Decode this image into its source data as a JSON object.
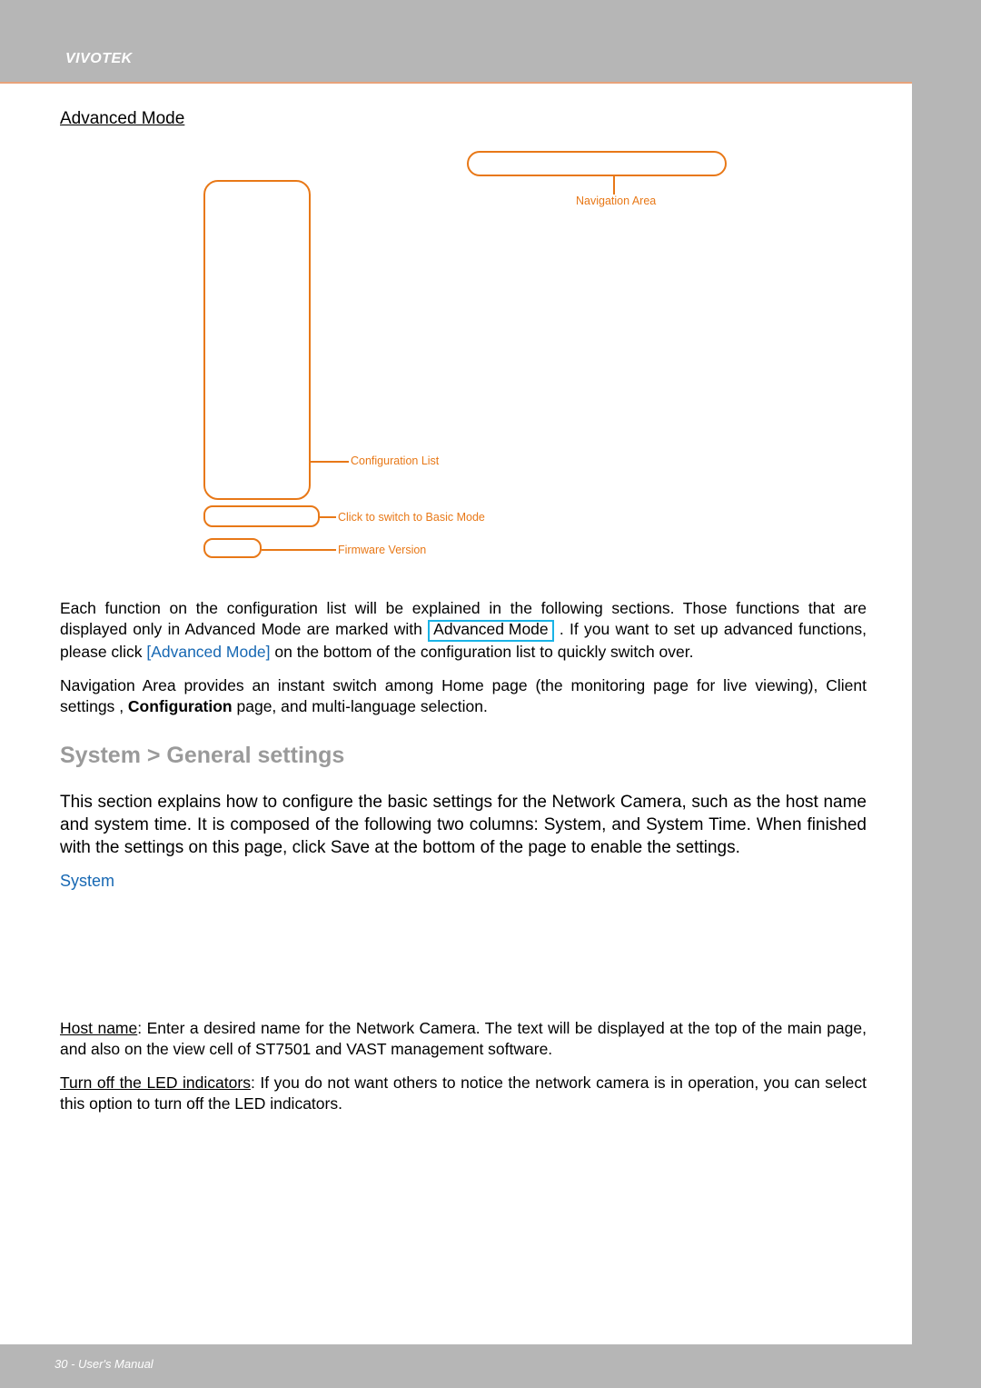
{
  "brand": "VIVOTEK",
  "section_title": "Advanced Mode",
  "diagram": {
    "navigation_area": "Navigation Area",
    "configuration_list": "Configuration List",
    "switch_basic": "Click to switch to Basic Mode",
    "firmware_version": "Firmware Version"
  },
  "para1_a": "Each function on the configuration list will be explained in the following sections. Those functions that are displayed only in Advanced Mode are marked with ",
  "adv_mode_badge": "Advanced Mode",
  "para1_b": ". If you want to set up advanced functions, please click ",
  "adv_mode_link": "[Advanced Mode]",
  "para1_c": " on the bottom of the configuration list to quickly switch over.",
  "para2_a": "Navigation Area provides an instant switch among Home page (the monitoring page for live viewing), ",
  "para2_client": "Client settings",
  "para2_b": ", ",
  "para2_config": "Configuration",
  "para2_c": " page, and multi-language selection.",
  "h2": "System > General settings",
  "para3": "This section explains how to configure the basic settings for the Network Camera, such as the host name and system time. It is composed of the following two columns: System, and System Time. When finished with the settings on this page, click Save at the bottom of the page to enable the settings.",
  "system_label": "System",
  "hostname_label": "Host name",
  "para4": ": Enter a desired name for the Network Camera. The text will be displayed at the top of the main page, and also on the view cell of ST7501 and VAST management software.",
  "led_label": "Turn off the LED indicators",
  "para5": ": If you do not want others to notice the network camera is in operation, you can select this option to turn off the LED indicators.",
  "footer": "30 - User's Manual"
}
